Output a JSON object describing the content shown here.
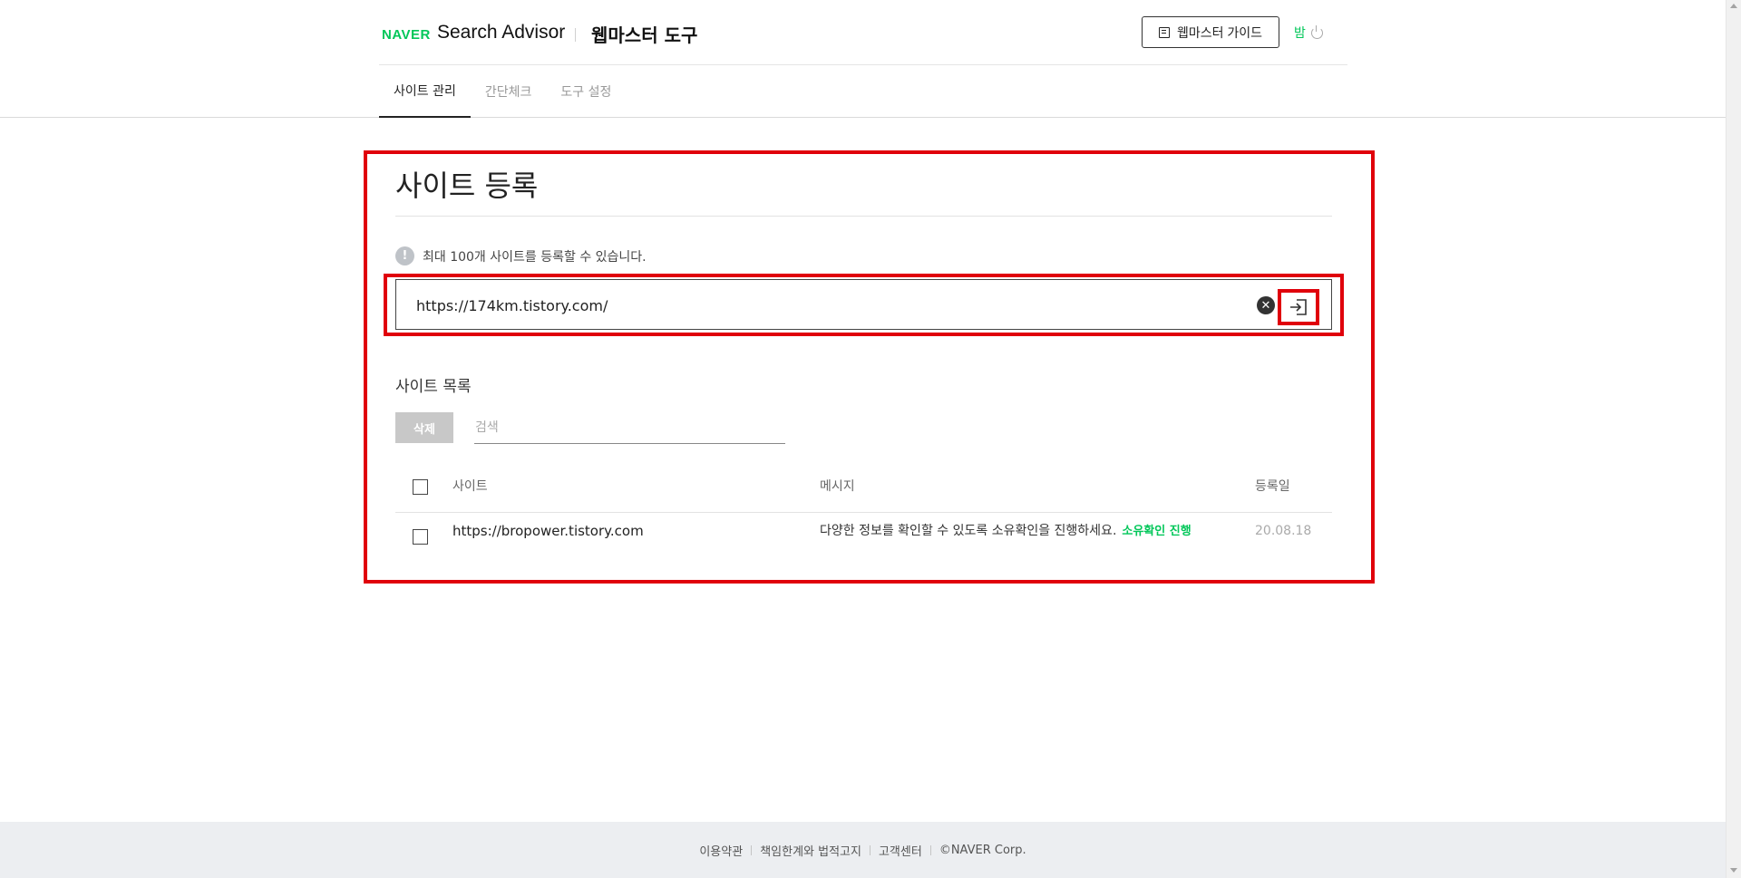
{
  "header": {
    "logo": "NAVER",
    "service": "Search Advisor",
    "tool": "웹마스터 도구",
    "guide_button": "웹마스터 가이드",
    "night_label": "밤"
  },
  "tabs": [
    {
      "label": "사이트 관리",
      "active": true
    },
    {
      "label": "간단체크",
      "active": false
    },
    {
      "label": "도구 설정",
      "active": false
    }
  ],
  "register": {
    "title": "사이트 등록",
    "notice": "최대 100개 사이트를 등록할 수 있습니다.",
    "url_value": "https://174km.tistory.com/"
  },
  "site_list": {
    "title": "사이트 목록",
    "delete_label": "삭제",
    "search_placeholder": "검색",
    "columns": {
      "site": "사이트",
      "message": "메시지",
      "date": "등록일"
    },
    "rows": [
      {
        "site": "https://bropower.tistory.com",
        "message": "다양한 정보를 확인할 수 있도록 소유확인을 진행하세요.",
        "action": "소유확인 진행",
        "date": "20.08.18"
      }
    ]
  },
  "footer": {
    "links": [
      "이용약관",
      "책임한계와 법적고지",
      "고객센터"
    ],
    "copyright": "©NAVER Corp."
  },
  "colors": {
    "brand": "#03c75a",
    "highlight": "#e0000b"
  },
  "icons": [
    "book-icon",
    "power-icon",
    "info-icon",
    "clear-icon",
    "submit-arrow-icon"
  ]
}
